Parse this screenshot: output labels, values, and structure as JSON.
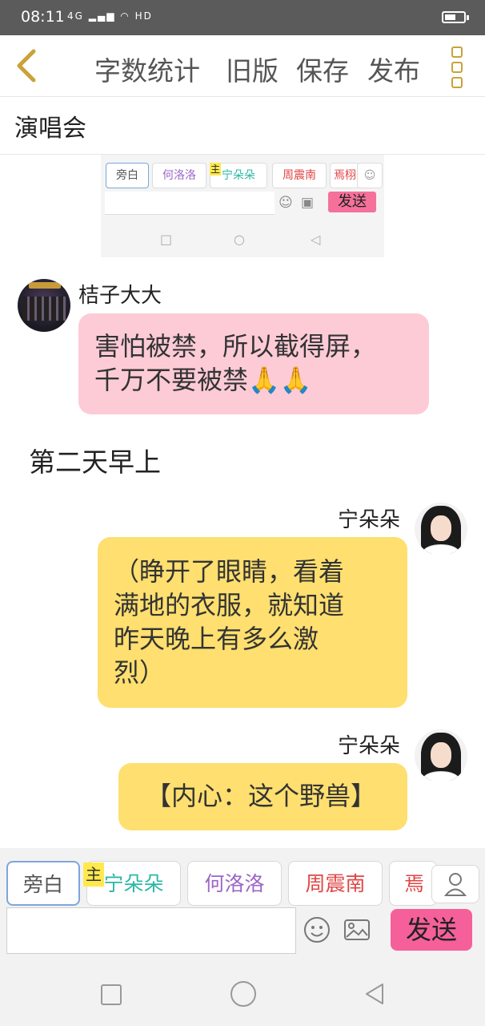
{
  "status": {
    "time": "08:11",
    "network": "4G",
    "hd": "HD"
  },
  "toolbar": {
    "word_count": "字数统计",
    "old_version": "旧版",
    "save": "保存",
    "publish": "发布"
  },
  "page_title": "演唱会",
  "screenshot_preview": {
    "tabs": [
      "旁白",
      "何洛洛",
      "宁朵朵",
      "周震南",
      "焉栩"
    ],
    "badge": "主",
    "send": "发送"
  },
  "messages": [
    {
      "speaker": "桔子大大",
      "text_lines": [
        "害怕被禁，所以截得屏，",
        "千万不要被禁🙏🙏"
      ],
      "side": "left",
      "color": "#fccbd6"
    },
    {
      "narration": "第二天早上"
    },
    {
      "speaker": "宁朵朵",
      "text_lines": [
        "（睁开了眼睛，看着",
        "满地的衣服，就知道",
        "昨天晚上有多么激",
        "烈）"
      ],
      "side": "right",
      "color": "#fedf6f"
    },
    {
      "speaker": "宁朵朵",
      "text_lines": [
        "【内心：这个野兽】"
      ],
      "side": "right",
      "color": "#fedf6f"
    }
  ],
  "compose": {
    "tabs": [
      {
        "label": "旁白",
        "color": "#555555"
      },
      {
        "label": "宁朵朵",
        "color": "#2cb8a6"
      },
      {
        "label": "何洛洛",
        "color": "#9a66c8"
      },
      {
        "label": "周震南",
        "color": "#e04545"
      },
      {
        "label": "焉栩",
        "color": "#e04545"
      }
    ],
    "main_badge": "主",
    "input_value": "",
    "send_label": "发送"
  },
  "icons": [
    "back-arrow-icon",
    "more-icon",
    "emoji-icon",
    "image-icon",
    "user-icon",
    "nav-square-icon",
    "nav-circle-icon",
    "nav-back-icon"
  ]
}
